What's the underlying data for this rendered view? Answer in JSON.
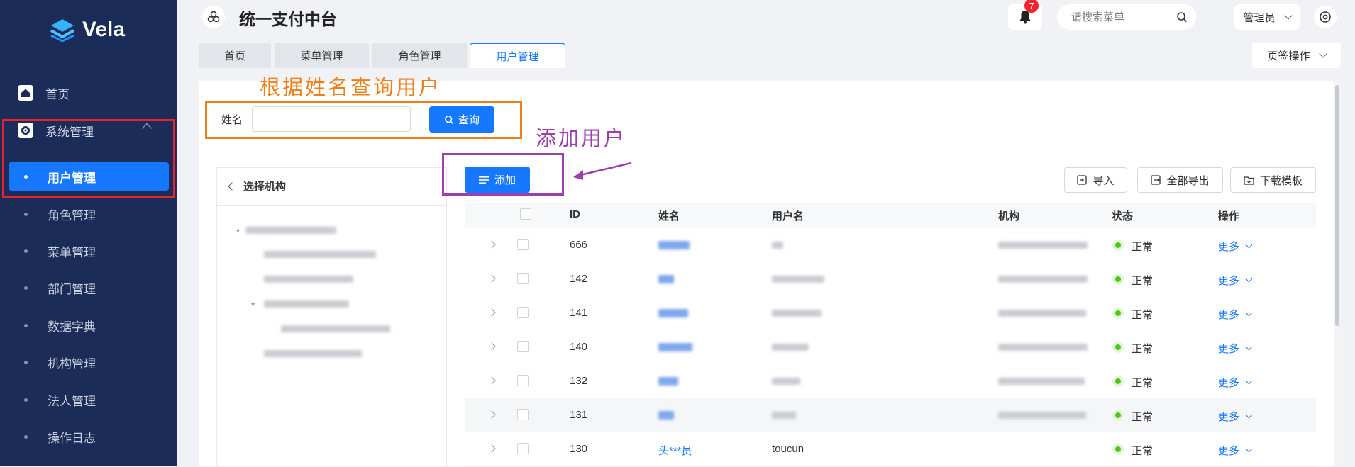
{
  "app": {
    "brand": "Vela",
    "title": "统一支付中台"
  },
  "header": {
    "notification_count": "7",
    "search_placeholder": "请搜索菜单",
    "user_label": "管理员"
  },
  "sidebar": {
    "items": [
      {
        "label": "首页"
      },
      {
        "label": "系统管理"
      },
      {
        "label": "用户管理"
      },
      {
        "label": "角色管理"
      },
      {
        "label": "菜单管理"
      },
      {
        "label": "部门管理"
      },
      {
        "label": "数据字典"
      },
      {
        "label": "机构管理"
      },
      {
        "label": "法人管理"
      },
      {
        "label": "操作日志"
      }
    ]
  },
  "tabs": [
    {
      "label": "首页"
    },
    {
      "label": "菜单管理"
    },
    {
      "label": "角色管理"
    },
    {
      "label": "用户管理"
    }
  ],
  "tab_actions_label": "页签操作",
  "search": {
    "name_label": "姓名",
    "query_button": "查询"
  },
  "annotations": {
    "search_note": "根据姓名查询用户",
    "add_note": "添加用户"
  },
  "org_panel": {
    "title": "选择机构"
  },
  "toolbar": {
    "add_button": "添加",
    "import_button": "导入",
    "export_all_button": "全部导出",
    "download_template_button": "下载模板"
  },
  "table": {
    "columns": [
      "ID",
      "姓名",
      "用户名",
      "机构",
      "状态",
      "操作"
    ],
    "rows": [
      {
        "id": "666",
        "status": "正常",
        "action": "更多"
      },
      {
        "id": "142",
        "status": "正常",
        "action": "更多"
      },
      {
        "id": "141",
        "status": "正常",
        "action": "更多"
      },
      {
        "id": "140",
        "status": "正常",
        "action": "更多"
      },
      {
        "id": "132",
        "status": "正常",
        "action": "更多"
      },
      {
        "id": "131",
        "status": "正常",
        "action": "更多"
      },
      {
        "id": "130",
        "name": "头***员",
        "username": "toucun",
        "status": "正常",
        "action": "更多"
      }
    ]
  },
  "colors": {
    "sidebar_bg": "#1b2c59",
    "primary": "#1677ff",
    "annotation_orange": "#f07f1a",
    "annotation_purple": "#9b3fb0",
    "highlight_red": "#e8212b"
  }
}
